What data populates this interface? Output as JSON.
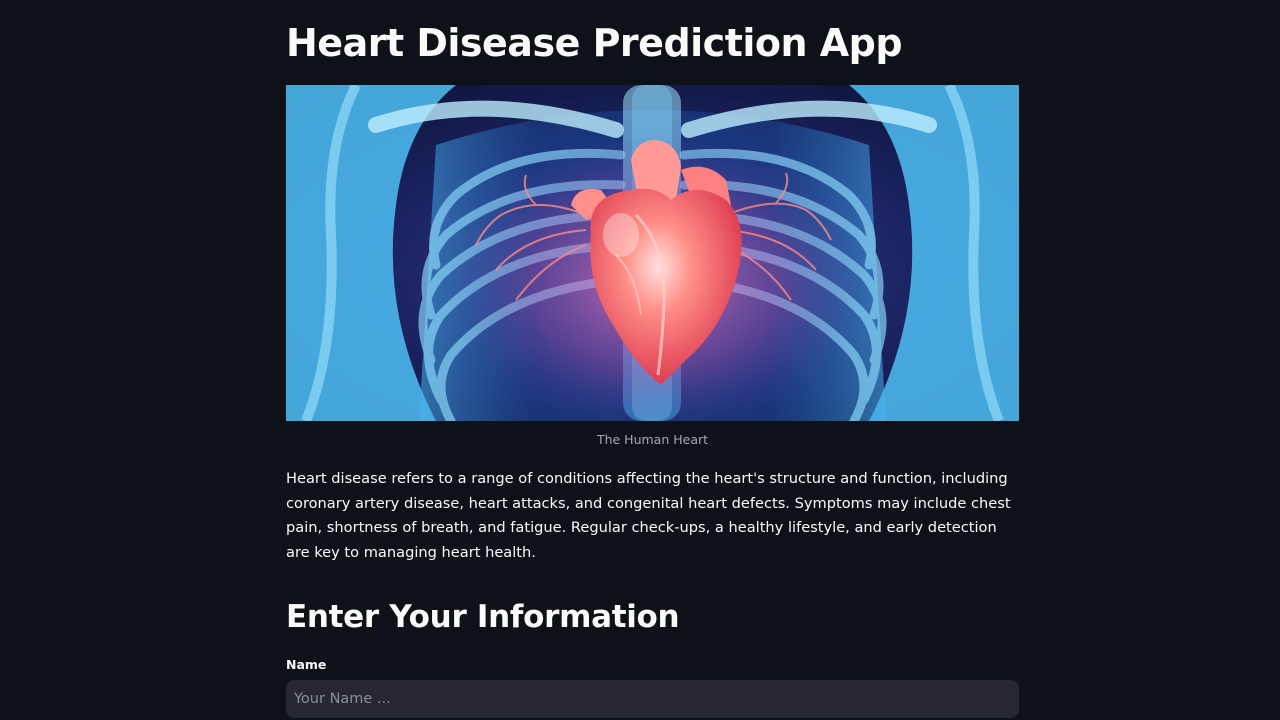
{
  "app": {
    "title": "Heart Disease Prediction App"
  },
  "hero_image": {
    "icon": "human-heart-xray-image",
    "caption": "The Human Heart",
    "colors": {
      "background": "#101536",
      "xray_blue": "#58c8ff",
      "heart_red": "#ff5e62"
    }
  },
  "description": "Heart disease refers to a range of conditions affecting the heart's structure and function, including coronary artery disease, heart attacks, and congenital heart defects. Symptoms may include chest pain, shortness of breath, and fatigue. Regular check-ups, a healthy lifestyle, and early detection are key to managing heart health.",
  "form": {
    "heading": "Enter Your Information",
    "name_field": {
      "label": "Name",
      "value": "",
      "placeholder": "Your Name ..."
    }
  },
  "theme": {
    "page_background": "#0e1117",
    "text": "#fafafa",
    "input_background": "#262730",
    "caption_text": "#a3a8b8"
  }
}
